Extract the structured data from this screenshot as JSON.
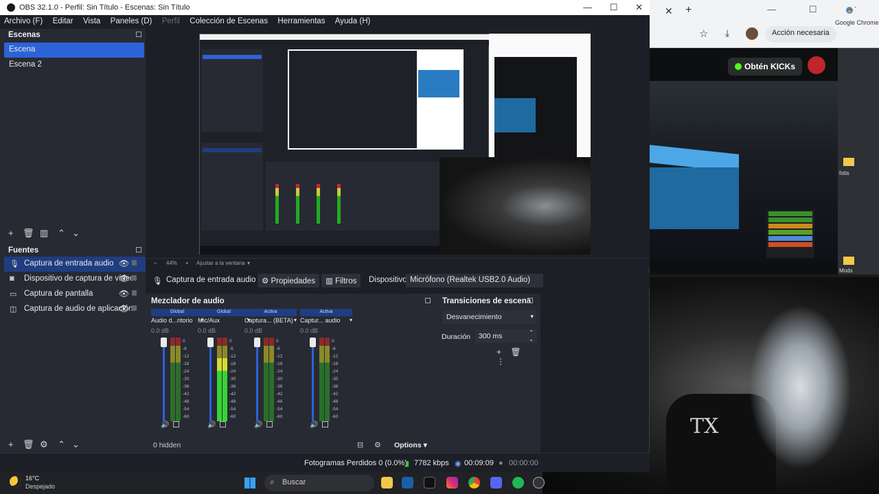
{
  "window": {
    "title": "OBS 32.1.0 - Perfil: Sin Título - Escenas: Sin Título",
    "controls": [
      "—",
      "☐",
      "✕"
    ]
  },
  "menu": [
    "Archivo (F)",
    "Editar",
    "Vista",
    "Paneles (D)",
    "Perfil",
    "Colección de Escenas",
    "Herramientas",
    "Ayuda (H)"
  ],
  "scenes": {
    "title": "Escenas",
    "items": [
      {
        "label": "Escena",
        "active": true
      },
      {
        "label": "Escena 2",
        "active": false
      }
    ]
  },
  "sources": {
    "title": "Fuentes",
    "items": [
      {
        "label": "Captura de entrada audio",
        "icon": "microphone-icon",
        "active": true
      },
      {
        "label": "Dispositivo de captura de vídeo",
        "icon": "camera-icon",
        "active": false
      },
      {
        "label": "Captura de pantalla",
        "icon": "monitor-icon",
        "active": false
      },
      {
        "label": "Captura de audio de aplicación",
        "icon": "speaker-icon",
        "active": false
      }
    ]
  },
  "preview": {
    "zoom": "44%",
    "fit_label": "Ajustar a la ventana"
  },
  "context_bar": {
    "source_name": "Captura de entrada audio",
    "properties": "Propiedades",
    "filters": "Filtros",
    "device_label": "Dispositivo",
    "device_value": "Micrófono (Realtek USB2.0 Audio)"
  },
  "mixer": {
    "title": "Mezclador de audio",
    "channels": [
      {
        "badge": "Global",
        "name": "Audio d...ritorio",
        "db": "0.0 dB",
        "level": 0.0
      },
      {
        "badge": "Global",
        "name": "Mic/Aux",
        "db": "0.0 dB",
        "level": 0.75
      },
      {
        "badge": "Activa",
        "name": "Captura... (BETA)",
        "db": "0.0 dB",
        "level": 0.0
      },
      {
        "badge": "Activa",
        "name": "Captur... audio",
        "db": "0.0 dB",
        "level": 0.0
      }
    ],
    "scale": [
      "0",
      "-6",
      "-12",
      "-18",
      "-24",
      "-30",
      "-36",
      "-42",
      "-48",
      "-54",
      "-60"
    ],
    "hidden_count": "0 hidden",
    "options_label": "Options"
  },
  "transitions": {
    "title": "Transiciones de escena",
    "selected": "Desvanecimiento",
    "duration_label": "Duración",
    "duration_value": "300 ms"
  },
  "status": {
    "dropped_frames": "Fotogramas Perdidos 0 (0.0%)",
    "bitrate": "7782 kbps",
    "stream_time": "00:09:09",
    "rec_time": "00:00:00"
  },
  "taskbar": {
    "temperature": "16°C",
    "condition": "Despejado",
    "search_placeholder": "Buscar"
  },
  "chrome": {
    "action_label": "Acción necesaria",
    "kick_button": "Obtén KICKs",
    "app_label": "Google Chrome"
  },
  "desktop": {
    "folder1": "fotis",
    "folder2": "Mods"
  },
  "webcam_text": "TX",
  "colors": {
    "accent": "#2c63d8",
    "kick_green": "#53fc18"
  }
}
